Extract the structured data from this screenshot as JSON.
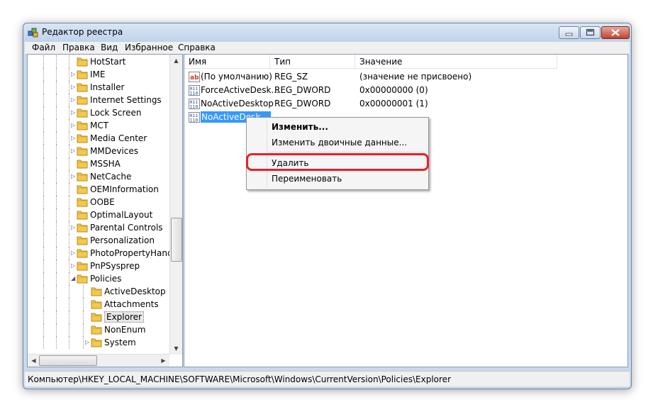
{
  "window": {
    "title": "Редактор реестра"
  },
  "menu": [
    "Файл",
    "Правка",
    "Вид",
    "Избранное",
    "Справка"
  ],
  "tree": {
    "items": [
      {
        "label": "HotStart",
        "level": 1,
        "expander": "",
        "selected": false
      },
      {
        "label": "IME",
        "level": 1,
        "expander": "▷",
        "selected": false
      },
      {
        "label": "Installer",
        "level": 1,
        "expander": "▷",
        "selected": false
      },
      {
        "label": "Internet Settings",
        "level": 1,
        "expander": "▷",
        "selected": false
      },
      {
        "label": "Lock Screen",
        "level": 1,
        "expander": "▷",
        "selected": false
      },
      {
        "label": "MCT",
        "level": 1,
        "expander": "▷",
        "selected": false
      },
      {
        "label": "Media Center",
        "level": 1,
        "expander": "▷",
        "selected": false
      },
      {
        "label": "MMDevices",
        "level": 1,
        "expander": "▷",
        "selected": false
      },
      {
        "label": "MSSHA",
        "level": 1,
        "expander": "",
        "selected": false
      },
      {
        "label": "NetCache",
        "level": 1,
        "expander": "▷",
        "selected": false
      },
      {
        "label": "OEMInformation",
        "level": 1,
        "expander": "",
        "selected": false
      },
      {
        "label": "OOBE",
        "level": 1,
        "expander": "",
        "selected": false
      },
      {
        "label": "OptimalLayout",
        "level": 1,
        "expander": "",
        "selected": false
      },
      {
        "label": "Parental Controls",
        "level": 1,
        "expander": "▷",
        "selected": false
      },
      {
        "label": "Personalization",
        "level": 1,
        "expander": "",
        "selected": false
      },
      {
        "label": "PhotoPropertyHand",
        "level": 1,
        "expander": "▷",
        "selected": false
      },
      {
        "label": "PnPSysprep",
        "level": 1,
        "expander": "▷",
        "selected": false
      },
      {
        "label": "Policies",
        "level": 1,
        "expander": "◢",
        "selected": false
      },
      {
        "label": "ActiveDesktop",
        "level": 2,
        "expander": "",
        "selected": false
      },
      {
        "label": "Attachments",
        "level": 2,
        "expander": "",
        "selected": false
      },
      {
        "label": "Explorer",
        "level": 2,
        "expander": "",
        "selected": true
      },
      {
        "label": "NonEnum",
        "level": 2,
        "expander": "",
        "selected": false
      },
      {
        "label": "System",
        "level": 2,
        "expander": "▷",
        "selected": false
      }
    ]
  },
  "list": {
    "columns": [
      "Имя",
      "Тип",
      "Значение"
    ],
    "rows": [
      {
        "icon": "string-value-icon",
        "name": "(По умолчанию)",
        "type": "REG_SZ",
        "value": "(значение не присвоено)",
        "selected": false
      },
      {
        "icon": "binary-value-icon",
        "name": "ForceActiveDesk...",
        "type": "REG_DWORD",
        "value": "0x00000000 (0)",
        "selected": false
      },
      {
        "icon": "binary-value-icon",
        "name": "NoActiveDesktop",
        "type": "REG_DWORD",
        "value": "0x00000001 (1)",
        "selected": false
      },
      {
        "icon": "binary-value-icon",
        "name": "NoActiveDesk...",
        "type": "",
        "value": "",
        "selected": true
      }
    ]
  },
  "context_menu": {
    "items": [
      "Изменить...",
      "Изменить двоичные данные...",
      "Удалить",
      "Переименовать"
    ],
    "highlight_color": "#e8202a"
  },
  "status_bar": {
    "path": "Компьютер\\HKEY_LOCAL_MACHINE\\SOFTWARE\\Microsoft\\Windows\\CurrentVersion\\Policies\\Explorer"
  },
  "colors": {
    "selection": "#3399ff",
    "frame": "#c7d9ee"
  }
}
